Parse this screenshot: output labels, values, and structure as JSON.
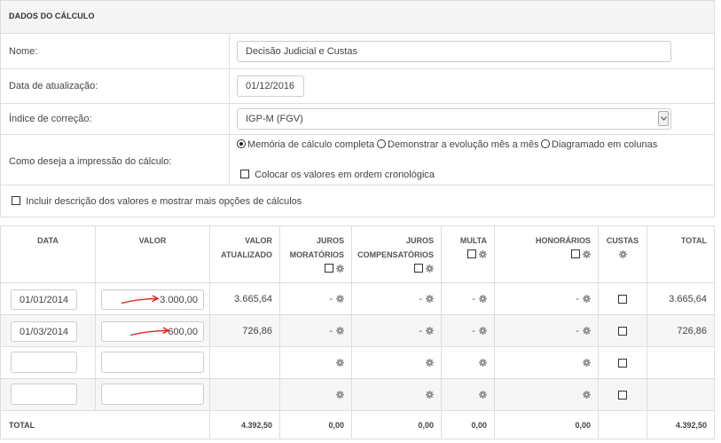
{
  "panel": {
    "title": "DADOS DO CÁLCULO",
    "nome_label": "Nome:",
    "nome_value": "Decisão Judicial e Custas",
    "data_label": "Data de atualização:",
    "data_value": "01/12/2016",
    "indice_label": "Índice de correção:",
    "indice_value": "IGP-M (FGV)",
    "impressao_label": "Como deseja a impressão do cálculo:",
    "impressao_options": [
      "Memória de cálculo completa",
      "Demonstrar a evolução mês a mês",
      "Diagramado em colunas"
    ],
    "impressao_selected": 0,
    "ordem_label": "Colocar os valores em ordem cronológica",
    "incluir_label": "Incluir descrição dos valores e mostrar mais opções de cálculos"
  },
  "table": {
    "headers": {
      "data": "DATA",
      "valor": "VALOR",
      "valor_atualizado_1": "VALOR",
      "valor_atualizado_2": "ATUALIZADO",
      "juros_mor_1": "JUROS",
      "juros_mor_2": "MORATÓRIOS",
      "juros_comp_1": "JUROS",
      "juros_comp_2": "COMPENSATÓRIOS",
      "multa": "MULTA",
      "honorarios": "HONORÁRIOS",
      "custas": "CUSTAS",
      "total": "TOTAL"
    },
    "rows": [
      {
        "data": "01/01/2014",
        "valor": "3.000,00",
        "atualizado": "3.665,64",
        "juros_mor": "-",
        "juros_comp": "-",
        "multa": "-",
        "honorarios": "-",
        "total": "3.665,64"
      },
      {
        "data": "01/03/2014",
        "valor": "600,00",
        "atualizado": "726,86",
        "juros_mor": "-",
        "juros_comp": "-",
        "multa": "-",
        "honorarios": "-",
        "total": "726,86"
      }
    ],
    "totals": {
      "label": "TOTAL",
      "atualizado": "4.392,50",
      "juros_mor": "0,00",
      "juros_comp": "0,00",
      "multa": "0,00",
      "honorarios": "0,00",
      "total": "4.392,50"
    }
  },
  "colors": {
    "border": "#dddddd",
    "header_bg": "#f5f5f5",
    "row_alt": "#f6f6f6",
    "arrow": "#e02020"
  },
  "icons": [
    "gear-icon",
    "checkbox-icon",
    "radio-icon",
    "chevron-down-icon",
    "red-arrow-annotation"
  ]
}
